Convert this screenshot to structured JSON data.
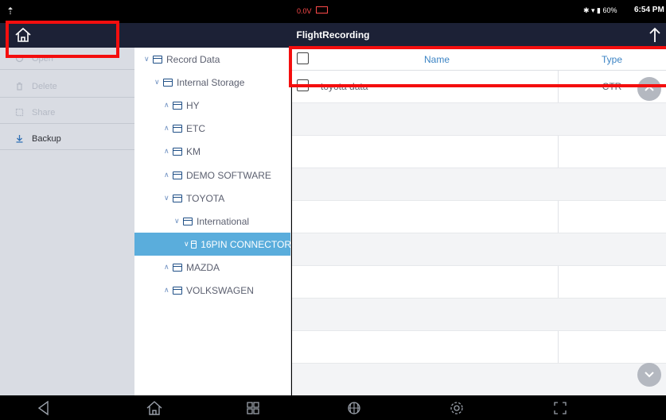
{
  "status_bar": {
    "notification_icon": "upload-arrow-icon",
    "voltage": "0.0V",
    "system_icons": "bluetooth wifi battery 60%",
    "time": "6:54 PM"
  },
  "title_bar": {
    "title": "FlightRecording",
    "home_icon": "home-icon",
    "upload_icon": "upload-icon"
  },
  "actions": [
    {
      "label": "Open",
      "icon": "open-icon",
      "enabled": false
    },
    {
      "label": "Delete",
      "icon": "trash-icon",
      "enabled": false
    },
    {
      "label": "Share",
      "icon": "share-icon",
      "enabled": false
    },
    {
      "label": "Backup",
      "icon": "download-icon",
      "enabled": true
    }
  ],
  "tree": [
    {
      "label": "Record Data",
      "expanded": true,
      "depth": 0
    },
    {
      "label": "Internal Storage",
      "expanded": true,
      "depth": 1
    },
    {
      "label": "HY",
      "expanded": false,
      "depth": 2
    },
    {
      "label": "ETC",
      "expanded": false,
      "depth": 2
    },
    {
      "label": "KM",
      "expanded": false,
      "depth": 2
    },
    {
      "label": "DEMO SOFTWARE",
      "expanded": false,
      "depth": 2
    },
    {
      "label": "TOYOTA",
      "expanded": true,
      "depth": 2
    },
    {
      "label": "International",
      "expanded": true,
      "depth": 3
    },
    {
      "label": "16PIN CONNECTOR",
      "expanded": true,
      "depth": 4,
      "selected": true
    },
    {
      "label": "MAZDA",
      "expanded": false,
      "depth": 2
    },
    {
      "label": "VOLKSWAGEN",
      "expanded": false,
      "depth": 2
    }
  ],
  "table": {
    "columns": [
      "Name",
      "Type"
    ],
    "rows": [
      {
        "name": "toyota data",
        "type": "CTR"
      }
    ]
  },
  "nav_bar": {
    "buttons": [
      "back-icon",
      "home-icon",
      "recent-apps-icon",
      "browser-icon",
      "settings-icon",
      "screenshot-icon"
    ]
  },
  "colors": {
    "title_bar": "#1c2136",
    "selected_node": "#5aaddc",
    "highlight": "#f40e0e",
    "header_text": "#3c84c4"
  }
}
